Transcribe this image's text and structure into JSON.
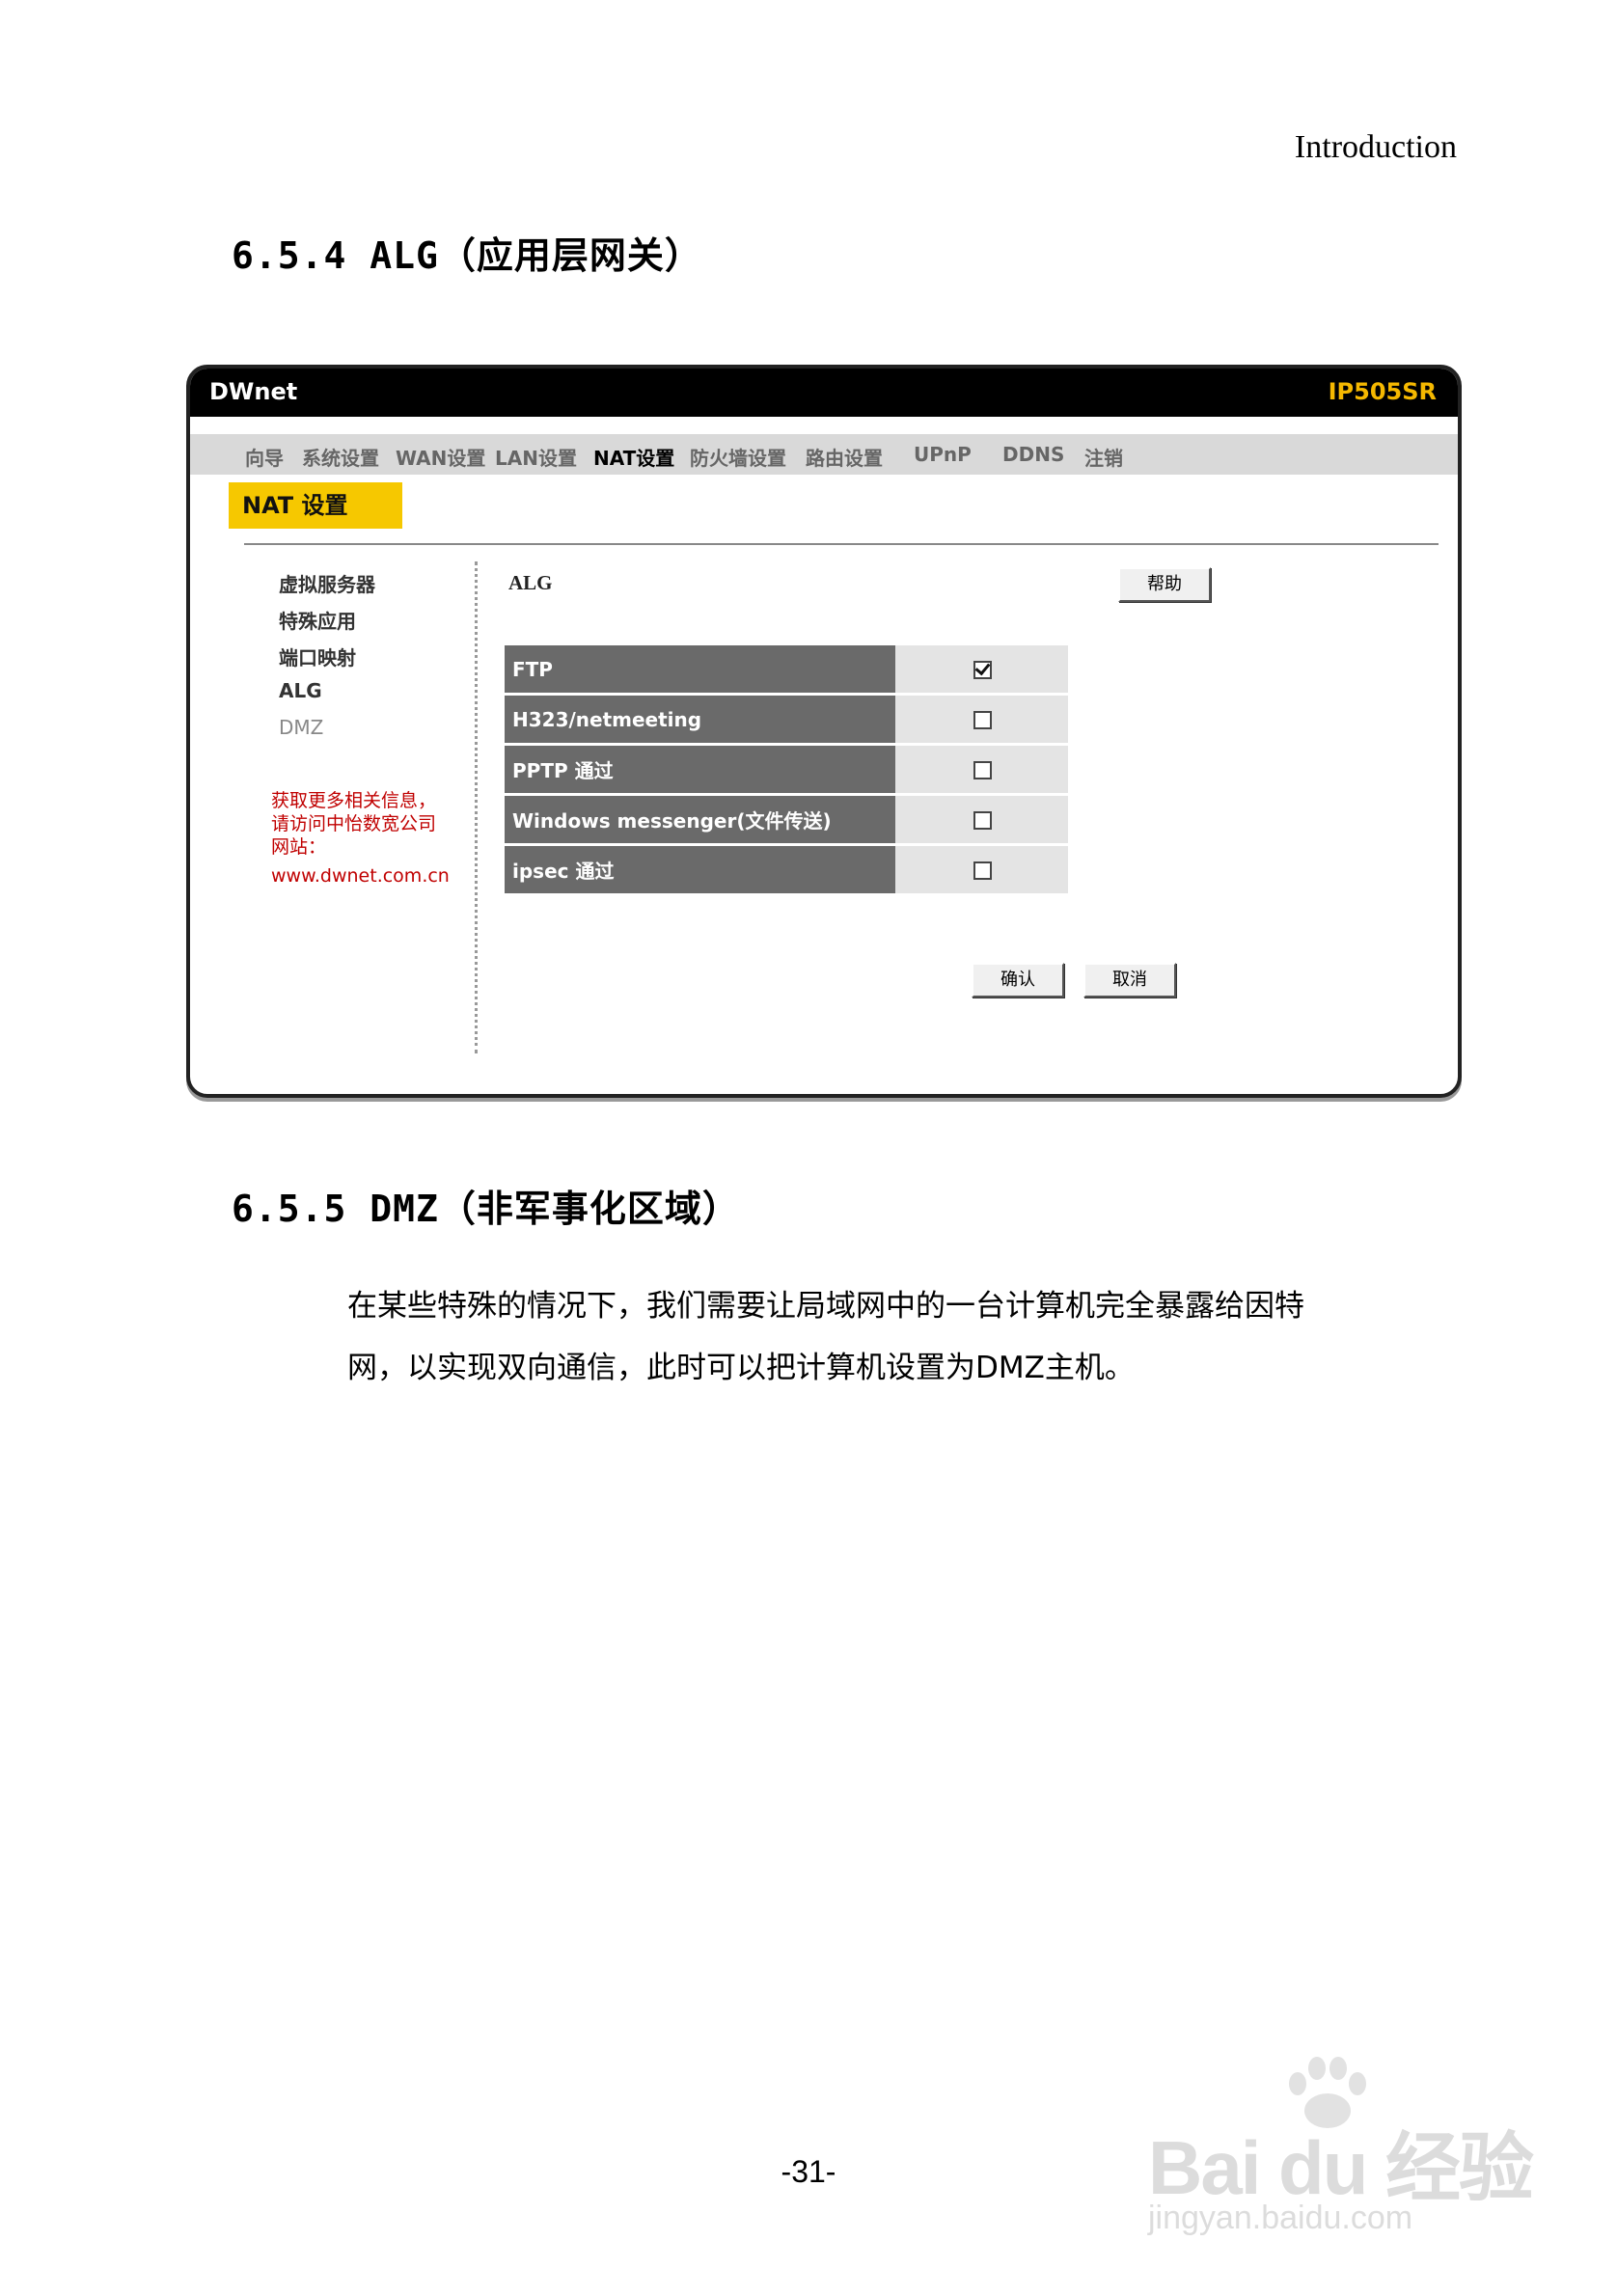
{
  "header": {
    "right_label": "Introduction"
  },
  "sections": {
    "alg_title": "6.5.4 ALG（应用层网关）",
    "dmz_title": "6.5.5 DMZ（非军事化区域）",
    "dmz_text_1": "在某些特殊的情况下，我们需要让局域网中的一台计算机完全暴露给因特",
    "dmz_text_2": "网，以实现双向通信，此时可以把计算机设置为DMZ主机。"
  },
  "screenshot": {
    "brand": "DWnet",
    "model": "IP505SR",
    "nav": [
      "向导",
      "系统设置",
      "WAN设置",
      "LAN设置",
      "NAT设置",
      "防火墙设置",
      "路由设置",
      "UPnP",
      "DDNS",
      "注销"
    ],
    "active_nav": "NAT设置",
    "page_title": "NAT 设置",
    "sidebar": [
      "虚拟服务器",
      "特殊应用",
      "端口映射",
      "ALG",
      "DMZ"
    ],
    "info": {
      "line1": "获取更多相关信息，",
      "line2": "请访问中怡数宽公司",
      "line3": "网站：",
      "url": "www.dwnet.com.cn"
    },
    "alg_label": "ALG",
    "help_button": "帮助",
    "options": [
      {
        "label": "FTP",
        "checked": true
      },
      {
        "label": "H323/netmeeting",
        "checked": false
      },
      {
        "label": "PPTP 通过",
        "checked": false
      },
      {
        "label": "Windows messenger(文件传送)",
        "checked": false
      },
      {
        "label": "ipsec 通过",
        "checked": false
      }
    ],
    "ok_button": "确认",
    "cancel_button": "取消"
  },
  "page_number": "-31-",
  "watermark": {
    "main": "Bai du 经验",
    "sub": "jingyan.baidu.com"
  },
  "colors": {
    "model_text": "#f5b800",
    "title_bg": "#f6c800",
    "info_text": "#c00000",
    "option_bg": "#6a6a6a"
  }
}
